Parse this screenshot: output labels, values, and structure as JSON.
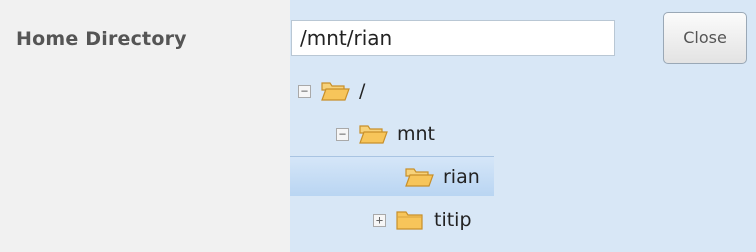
{
  "form": {
    "label": "Home Directory",
    "path_value": "/mnt/rian",
    "close_label": "Close"
  },
  "tree": {
    "nodes": [
      {
        "label": "/",
        "toggle": "−",
        "expanded": true,
        "icon": "folder-open-icon"
      },
      {
        "label": "mnt",
        "toggle": "−",
        "expanded": true,
        "icon": "folder-open-icon"
      },
      {
        "label": "rian",
        "selected": true,
        "icon": "folder-open-icon"
      },
      {
        "label": "titip",
        "toggle": "+",
        "expanded": false,
        "icon": "folder-closed-icon"
      }
    ]
  },
  "colors": {
    "panel_bg": "#d8e7f6",
    "label_bg": "#f1f1f1",
    "selected_bg": "#c6dcf4",
    "folder_fill": "#f7c55a"
  }
}
